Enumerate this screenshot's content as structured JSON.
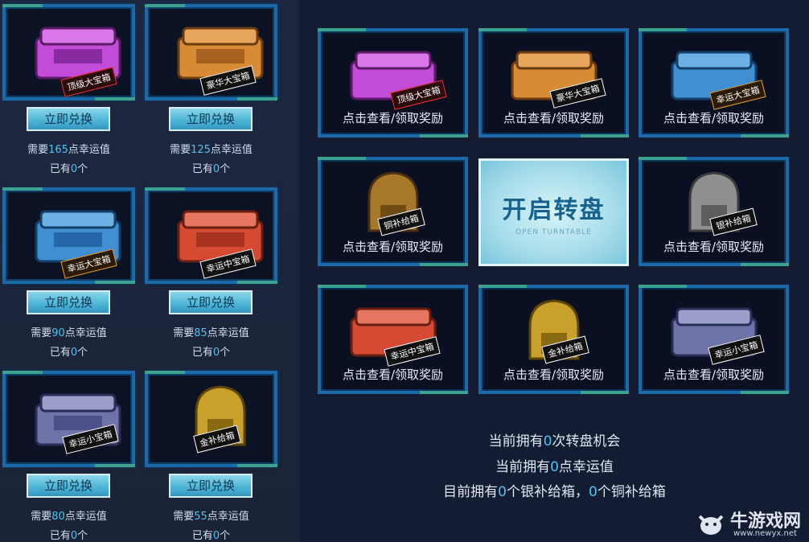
{
  "colors": {
    "accent": "#4dc3ef",
    "frame_blue": "#1b69a8",
    "frame_green": "#3aa28f"
  },
  "exchange": {
    "items": [
      {
        "tag": "顶级大宝箱",
        "button": "立即兑换",
        "need_pre": "需要",
        "need": "165",
        "need_post": "点幸运值",
        "own_pre": "已有",
        "own": "0",
        "own_post": "个",
        "color": "#c24bd8"
      },
      {
        "tag": "豪华大宝箱",
        "button": "立即兑换",
        "need_pre": "需要",
        "need": "125",
        "need_post": "点幸运值",
        "own_pre": "已有",
        "own": "0",
        "own_post": "个",
        "color": "#d98a34"
      },
      {
        "tag": "幸运大宝箱",
        "button": "立即兑换",
        "need_pre": "需要",
        "need": "90",
        "need_post": "点幸运值",
        "own_pre": "已有",
        "own": "0",
        "own_post": "个",
        "color": "#3f8fd2"
      },
      {
        "tag": "幸运中宝箱",
        "button": "立即兑换",
        "need_pre": "需要",
        "need": "85",
        "need_post": "点幸运值",
        "own_pre": "已有",
        "own": "0",
        "own_post": "个",
        "color": "#d44a33"
      },
      {
        "tag": "幸运小宝箱",
        "button": "立即兑换",
        "need_pre": "需要",
        "need": "80",
        "need_post": "点幸运值",
        "own_pre": "已有",
        "own": "0",
        "own_post": "个",
        "color": "#6f74a8"
      },
      {
        "tag": "金补给箱",
        "button": "立即兑换",
        "need_pre": "需要",
        "need": "55",
        "need_post": "点幸运值",
        "own_pre": "已有",
        "own": "0",
        "own_post": "个",
        "color": "#c9a02a"
      }
    ]
  },
  "rewards": {
    "caption": "点击查看/领取奖励",
    "cards": [
      {
        "tag": "顶级大宝箱",
        "color": "#c24bd8",
        "kind": "crate"
      },
      {
        "tag": "豪华大宝箱",
        "color": "#d98a34",
        "kind": "crate"
      },
      {
        "tag": "幸运大宝箱",
        "color": "#3f8fd2",
        "kind": "crate"
      },
      {
        "tag": "铜补给箱",
        "color": "#a7782a",
        "kind": "pod"
      },
      {
        "tag": "银补给箱",
        "color": "#8e8f90",
        "kind": "pod"
      },
      {
        "tag": "幸运中宝箱",
        "color": "#d44a33",
        "kind": "crate"
      },
      {
        "tag": "金补给箱",
        "color": "#c9a02a",
        "kind": "pod"
      },
      {
        "tag": "幸运小宝箱",
        "color": "#6f74a8",
        "kind": "crate"
      }
    ]
  },
  "turntable": {
    "title": "开启转盘",
    "subtitle": "OPEN TURNTABLE"
  },
  "stats": {
    "spin_pre": "当前拥有",
    "spin_count": "0",
    "spin_post": "次转盘机会",
    "luck_pre": "当前拥有",
    "luck_count": "0",
    "luck_post": "点幸运值",
    "box_pre": "目前拥有",
    "silver_count": "0",
    "silver_post": "个银补给箱，",
    "copper_count": "0",
    "copper_post": "个铜补给箱"
  },
  "watermark": {
    "title": "牛游戏网",
    "url": "www.newyx.net"
  }
}
